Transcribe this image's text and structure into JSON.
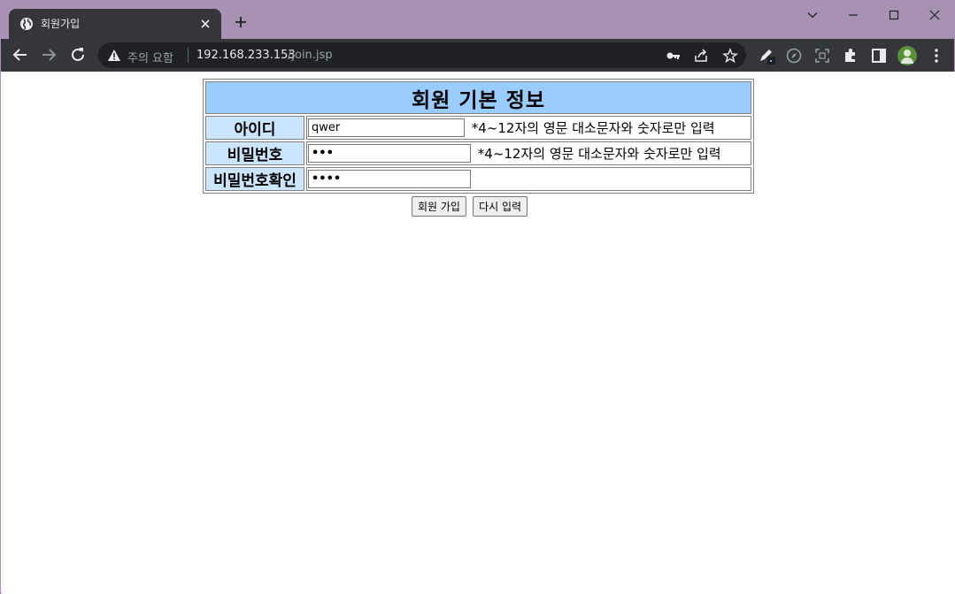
{
  "browser": {
    "tab_title": "회원가입",
    "security_label": "주의 요함",
    "url_host": "192.168.233.153",
    "url_path": "/join.jsp"
  },
  "form": {
    "header": "회원 기본 정보",
    "rows": [
      {
        "label": "아이디",
        "value": "qwer",
        "hint": "*4~12자의 영문 대소문자와 숫자로만 입력"
      },
      {
        "label": "비밀번호",
        "value": "•••",
        "hint": "*4~12자의 영문 대소문자와 숫자로만 입력"
      },
      {
        "label": "비밀번호확인",
        "value": "••••",
        "hint": ""
      }
    ],
    "submit_label": "회원 가입",
    "reset_label": "다시 입력"
  },
  "colors": {
    "header_bg": "#99ccff",
    "label_bg": "#cce5ff",
    "titlebar": "#a892b4",
    "toolbar": "#35363a"
  },
  "icons": [
    "globe-icon",
    "close-icon",
    "plus-icon",
    "minimize-icon",
    "maximize-icon",
    "window-close-icon",
    "chevron-down-icon",
    "back-icon",
    "forward-icon",
    "reload-icon",
    "warning-icon",
    "key-icon",
    "share-icon",
    "star-icon",
    "pen-icon",
    "compass-icon",
    "screenshot-icon",
    "puzzle-icon",
    "sidepanel-icon",
    "kebab-menu-icon"
  ]
}
